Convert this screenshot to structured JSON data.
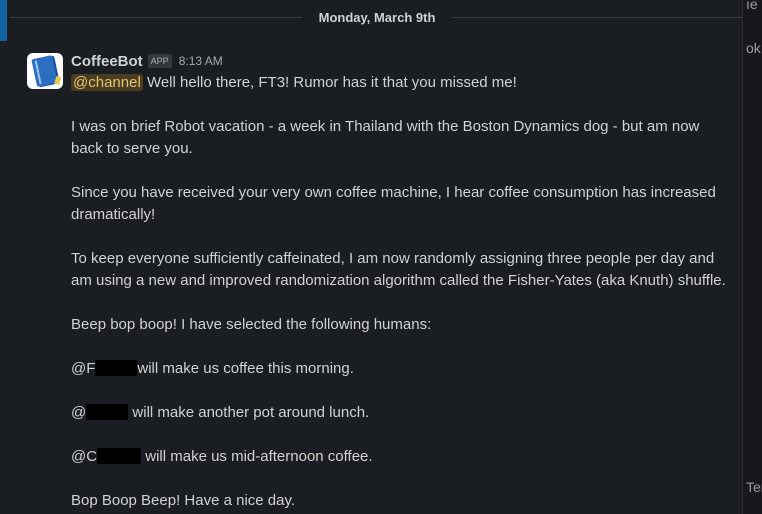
{
  "date_divider": "Monday, March 9th",
  "right_fragments": [
    "ıe",
    "ok",
    "Ter"
  ],
  "message": {
    "sender": "CoffeeBot",
    "badge": "APP",
    "time": "8:13 AM",
    "mention": "@channel",
    "line1_rest": " Well hello there, FT3! Rumor has it that you missed me!",
    "p2_line1": " I was on brief Robot vacation - a week in Thailand with the Boston Dynamics dog - but am now",
    "p2_line2": "back to serve you.",
    "p3_line1": " Since you have received your very own coffee machine, I hear coffee consumption has increased",
    "p3_line2": "dramatically!",
    "p4_line1": " To keep everyone sufficiently caffeinated, I am now randomly assigning three people per day and",
    "p4_line2": "am using a new and improved randomization algorithm called the Fisher-Yates (aka Knuth) shuffle.",
    "p5": " Beep bop boop!  I have selected the following humans:",
    "a1_prefix": " @F",
    "a1_suffix": "will make us coffee this morning.",
    "a2_prefix": " @",
    "a2_suffix": " will make another pot around lunch.",
    "a3_prefix": " @C",
    "a3_suffix": " will make us mid-afternoon coffee.",
    "p9": " Bop Boop Beep! Have a nice day."
  }
}
